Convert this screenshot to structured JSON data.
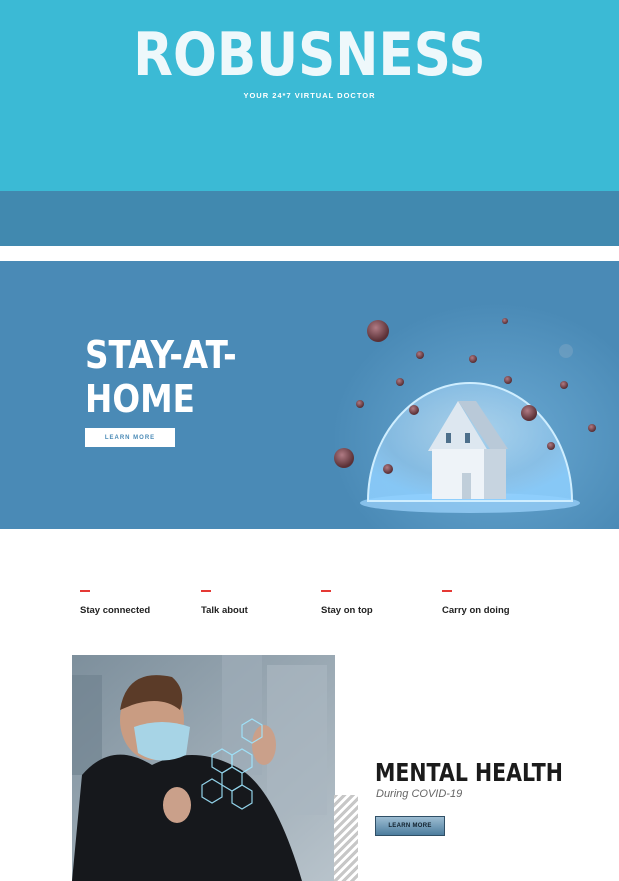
{
  "header": {
    "brand": "ROBUSNESS",
    "tagline": "YOUR 24*7 VIRTUAL DOCTOR"
  },
  "hero": {
    "title_line1": "STAY-AT-",
    "title_line2": "HOME",
    "button_label": "LEARN MORE",
    "image": "house-under-glass-dome-with-viruses"
  },
  "features": [
    {
      "label": "Stay connected"
    },
    {
      "label": "Talk about"
    },
    {
      "label": "Stay on top"
    },
    {
      "label": "Carry on doing"
    }
  ],
  "mental_health": {
    "title": "MENTAL HEALTH",
    "subtitle": "During COVID-19",
    "button_label": "LEARN MORE",
    "image": "man-in-face-mask-touching-hologram"
  },
  "colors": {
    "header_bg": "#3bbad5",
    "band_bg": "#4189af",
    "hero_bg": "#4a8ab6",
    "accent_red": "#e53935"
  }
}
